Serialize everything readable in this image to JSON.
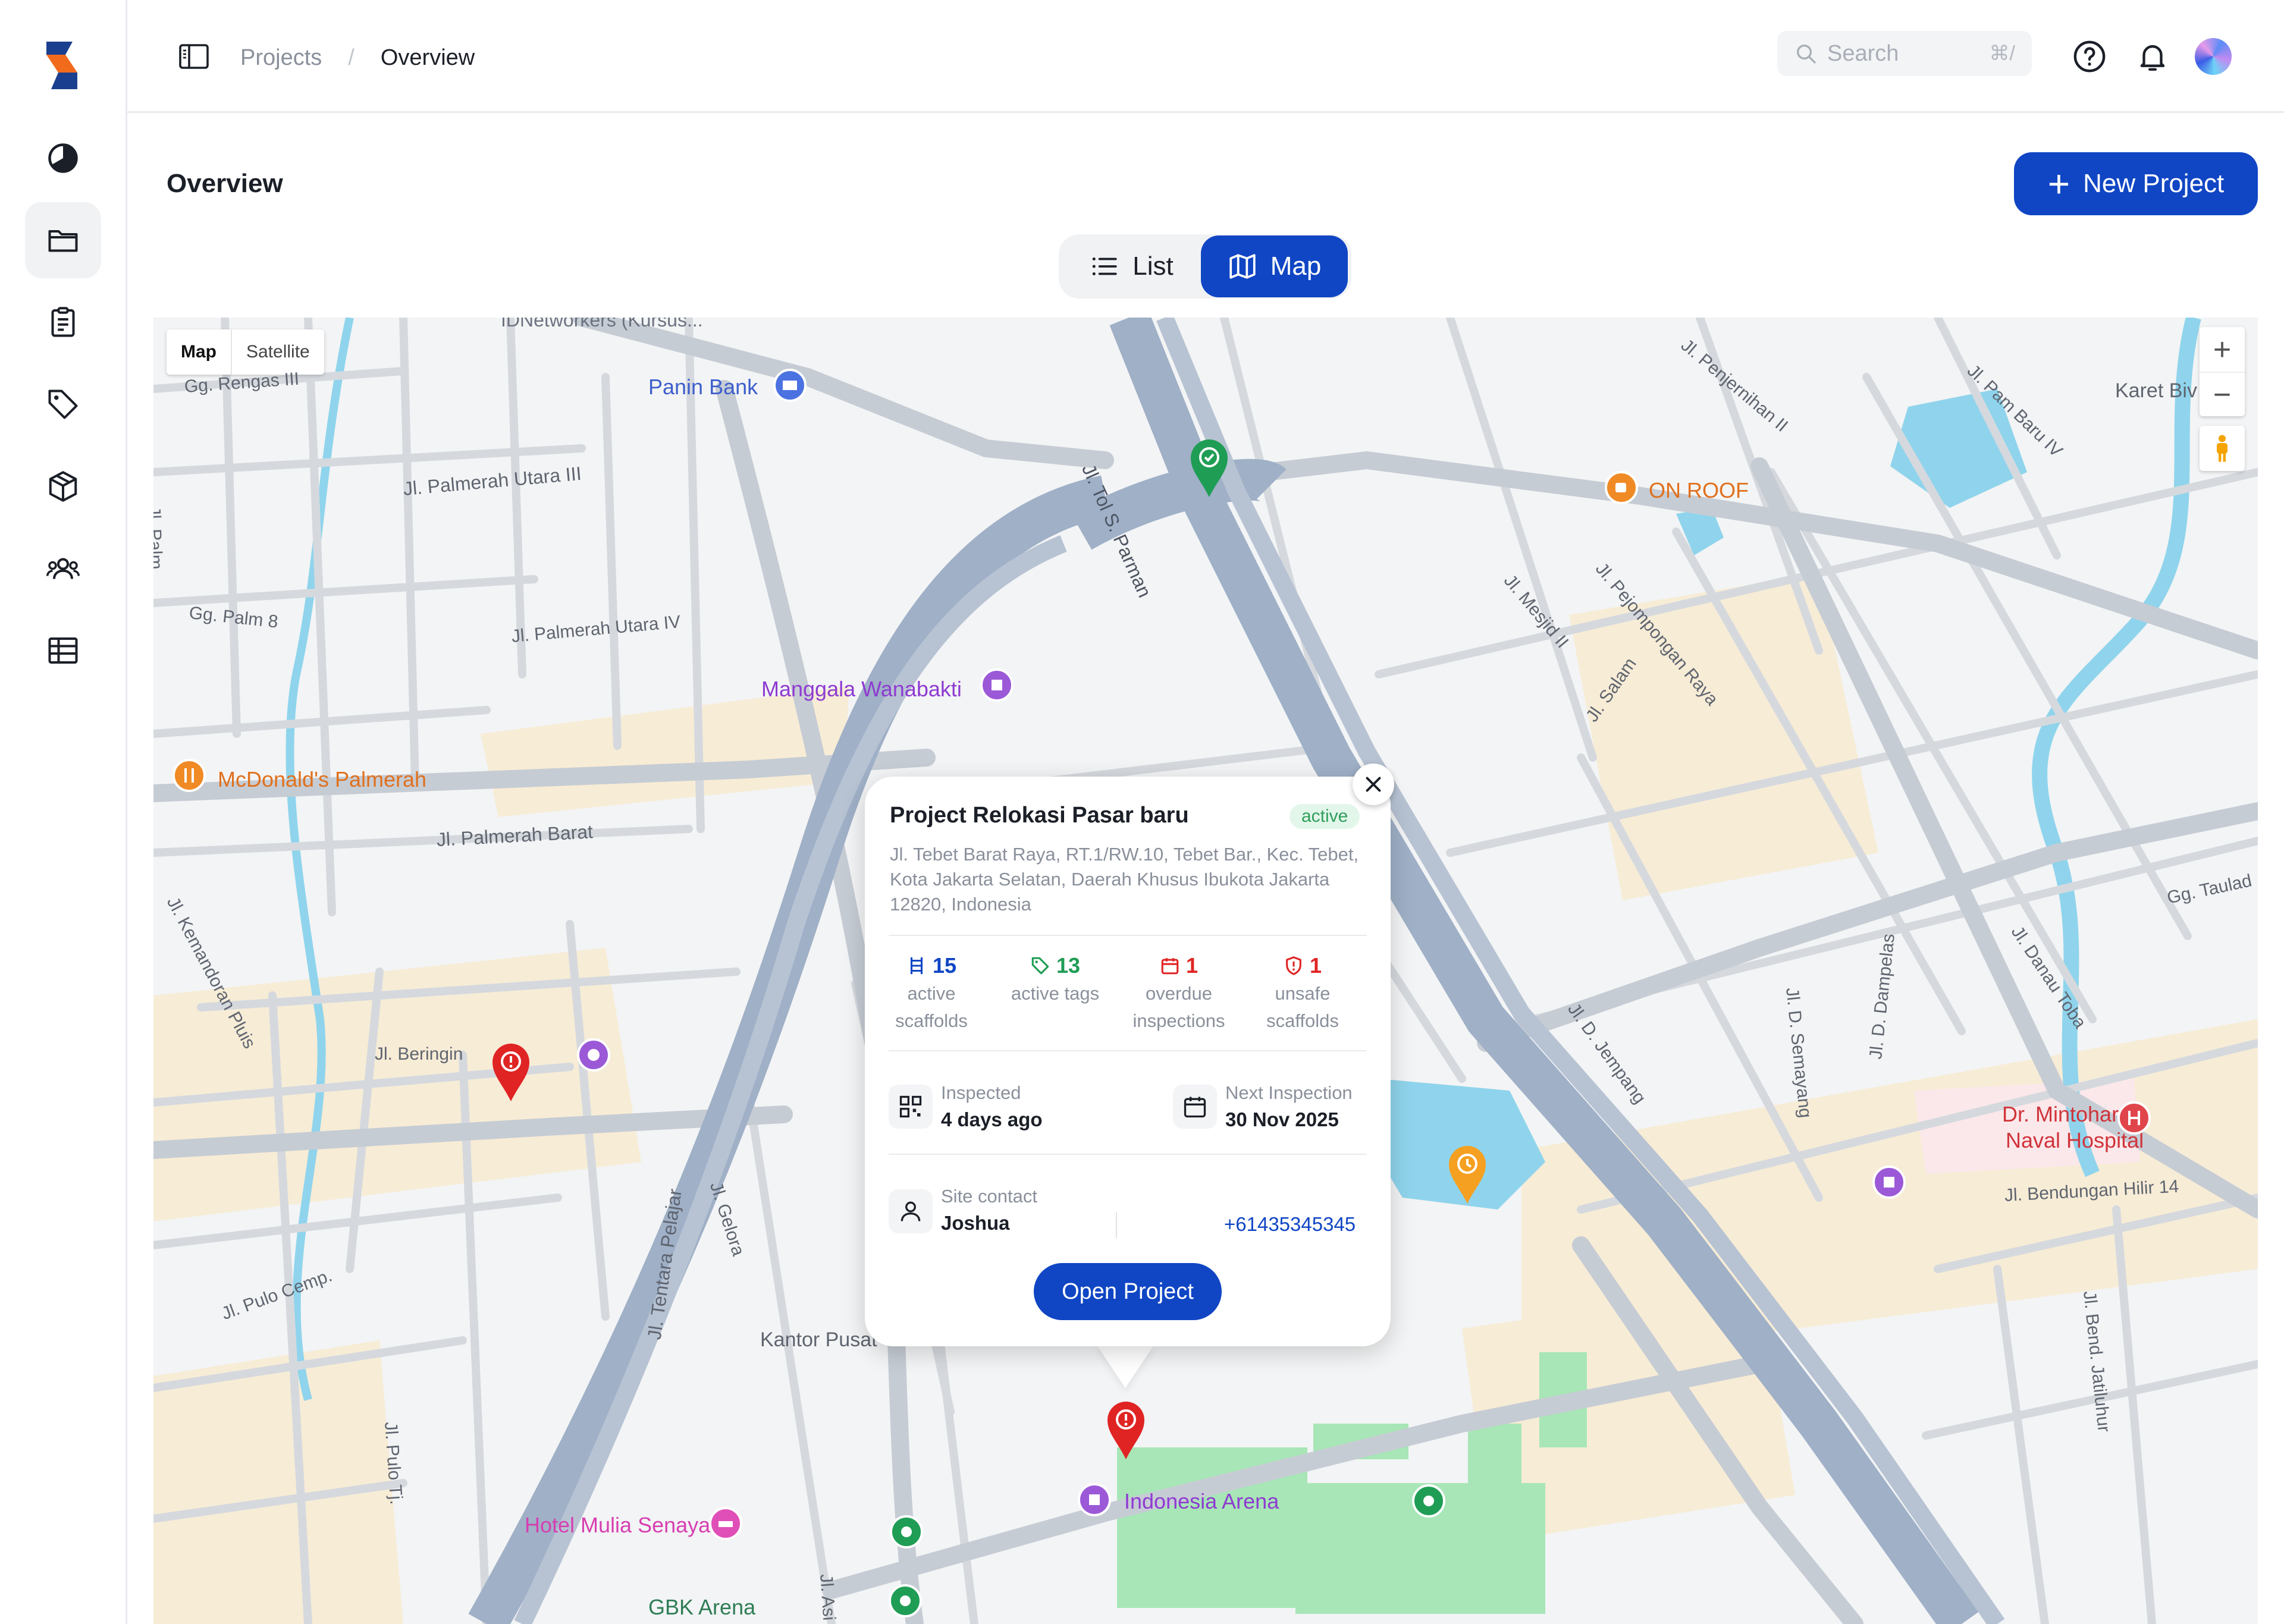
{
  "header": {
    "breadcrumb": [
      "Projects",
      "Overview"
    ],
    "search": {
      "placeholder": "Search",
      "shortcut": "⌘/"
    },
    "icons": [
      "help-icon",
      "bell-icon"
    ]
  },
  "sidebar": {
    "items": [
      {
        "name": "dashboard",
        "icon": "pie-chart-icon",
        "active": false
      },
      {
        "name": "projects",
        "icon": "folder-icon",
        "active": true
      },
      {
        "name": "inspections",
        "icon": "clipboard-icon",
        "active": false
      },
      {
        "name": "tags",
        "icon": "tag-icon",
        "active": false
      },
      {
        "name": "inventory",
        "icon": "box-icon",
        "active": false
      },
      {
        "name": "team",
        "icon": "users-icon",
        "active": false
      },
      {
        "name": "reports",
        "icon": "list-table-icon",
        "active": false
      }
    ]
  },
  "page": {
    "title": "Overview",
    "new_project_label": "New Project",
    "view_toggle": {
      "list_label": "List",
      "map_label": "Map",
      "selected": "Map"
    }
  },
  "map": {
    "type_options": [
      "Map",
      "Satellite"
    ],
    "selected_type": "Map",
    "zoom_in": "+",
    "zoom_out": "−",
    "poi": {
      "idnetworkers": "IDNetworkers (Kursus...",
      "panin_bank": "Panin Bank",
      "on_roof": "ON ROOF",
      "karet": "Karet Biv",
      "manggala": "Manggala Wanabakti",
      "mcdonalds": "McDonald's Palmerah",
      "dr_mintohardjo": "Dr. Mintohardjo\nNaval Hospital",
      "kantor_pusat": "Kantor Pusat",
      "hotel_mulia": "Hotel Mulia Senayan",
      "indonesia_arena": "Indonesia Arena",
      "gbk_arena": "GBK Arena"
    },
    "streets": {
      "rengas": "Gg. Rengas III",
      "palmerah_utara_3": "Jl. Palmerah Utara III",
      "palmerah_utara_4": "Jl. Palmerah Utara IV",
      "palm8": "Gg. Palm 8",
      "palm": "Jl. Palm",
      "palmerah_barat": "Jl. Palmerah Barat",
      "kemandoran": "Jl. Kemandoran Pluis",
      "beringin": "Jl. Beringin",
      "pulo_cemp": "Jl. Pulo Cemp.",
      "tentara_pelajar": "Jl. Tentara Pelajar",
      "gelora": "Jl. Gelora",
      "pulo": "Jl. Pulo Tj.",
      "asia": "Jl. Asi",
      "tol": "Jl. Tol S. Parman",
      "penjernihan": "Jl. Penjernihan II",
      "pam_baru": "Jl. Pam Baru IV",
      "mesjid": "Jl. Mesjid II",
      "pejompongan": "Jl. Pejompongan Raya",
      "salam": "Jl. Salam",
      "taulad": "Gg. Taulad",
      "d_semayang": "Jl. D. Semayang",
      "d_dampelas": "Jl. D. Dampelas",
      "danau_toba": "Jl. Danau Toba",
      "d_jempang": "Jl. D. Jempang",
      "bendungan": "Jl. Bendungan Hilir 14",
      "bend_jatiluhur": "Jl. Bend. Jatiluhur"
    }
  },
  "popup": {
    "title": "Project Relokasi Pasar baru",
    "status": "active",
    "address": "Jl. Tebet Barat Raya, RT.1/RW.10, Tebet Bar., Kec. Tebet, Kota Jakarta Selatan, Daerah Khusus Ibukota Jakarta 12820, Indonesia",
    "stats": [
      {
        "value": "15",
        "label": "active scaffolds",
        "color": "#1046c4",
        "icon": "scaffold-icon"
      },
      {
        "value": "13",
        "label": "active tags",
        "color": "#1f9d55",
        "icon": "tag-icon"
      },
      {
        "value": "1",
        "label": "overdue inspections",
        "color": "#e02424",
        "icon": "calendar-icon"
      },
      {
        "value": "1",
        "label": "unsafe scaffolds",
        "color": "#e02424",
        "icon": "shield-alert-icon"
      }
    ],
    "inspected_label": "Inspected",
    "inspected_value": "4 days ago",
    "next_label": "Next Inspection",
    "next_value": "30 Nov 2025",
    "contact_label": "Site contact",
    "contact_name": "Joshua",
    "contact_phone": "+61435345345",
    "open_label": "Open Project"
  },
  "colors": {
    "primary": "#1046c4",
    "active_badge_bg": "#e3f6ea",
    "active_badge_text": "#2e9f5b",
    "danger": "#e02424",
    "success": "#1f9d55"
  }
}
